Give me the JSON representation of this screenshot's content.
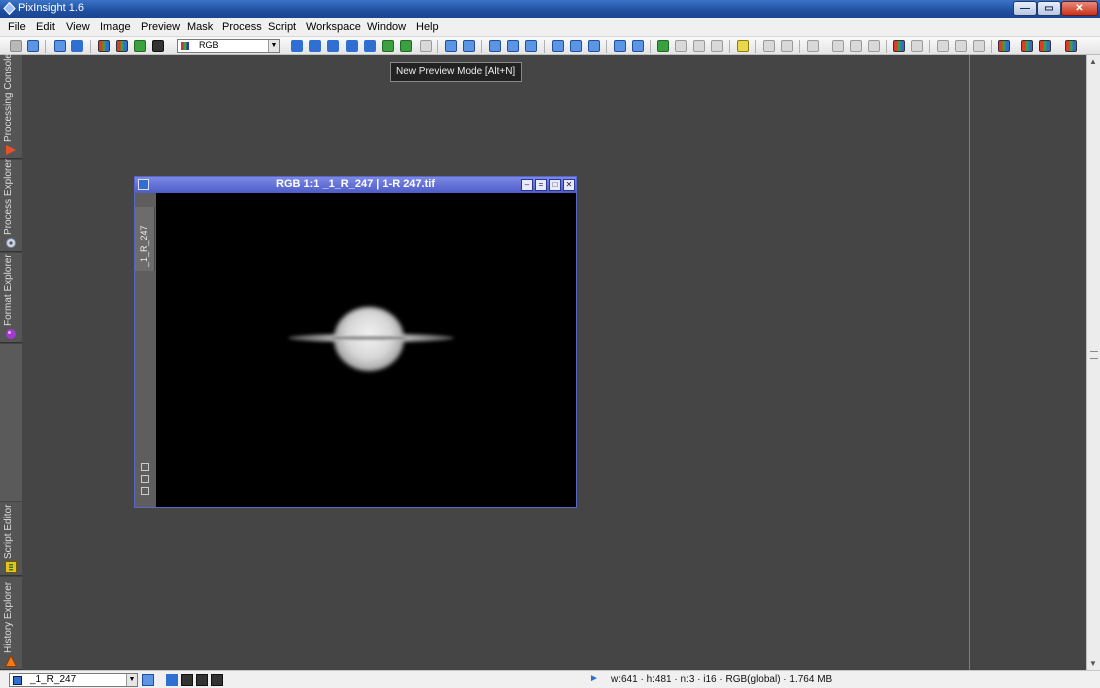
{
  "window": {
    "title": "PixInsight 1.6",
    "minimize_glyph": "—",
    "maximize_glyph": "▭",
    "close_glyph": "✕"
  },
  "menu": {
    "items": [
      "File",
      "Edit",
      "View",
      "Image",
      "Preview",
      "Mask",
      "Process",
      "Script",
      "Workspace",
      "Window",
      "Help"
    ]
  },
  "toolbar": {
    "color_space_value": "RGB",
    "dropdown_glyph": "▼"
  },
  "tooltip": {
    "text": "New Preview Mode [Alt+N]"
  },
  "sidebar": {
    "tabs": [
      "Processing Console",
      "Process Explorer",
      "Format Explorer",
      "Script Editor",
      "History Explorer"
    ]
  },
  "image_window": {
    "caption": "RGB 1:1  _1_R_247 | 1-R 247.tif",
    "view_tab": "_1_R_247",
    "min_glyph": "–",
    "shade_glyph": "=",
    "max_glyph": "□",
    "close_glyph": "✕"
  },
  "statusbar": {
    "view_selector_value": "_1_R_247",
    "dropdown_glyph": "▼",
    "info_arrow": "►",
    "info": "w:641 · h:481 · n:3 · i16 · RGB(global) · 1.764 MB"
  },
  "scrollbar": {
    "up_glyph": "▲",
    "down_glyph": "▼"
  },
  "colors": {
    "workspace_bg": "#454545",
    "titlebar": "#1f4f9e",
    "image_window_title": "#5866c8",
    "accent_blue": "#2f6fd1"
  }
}
